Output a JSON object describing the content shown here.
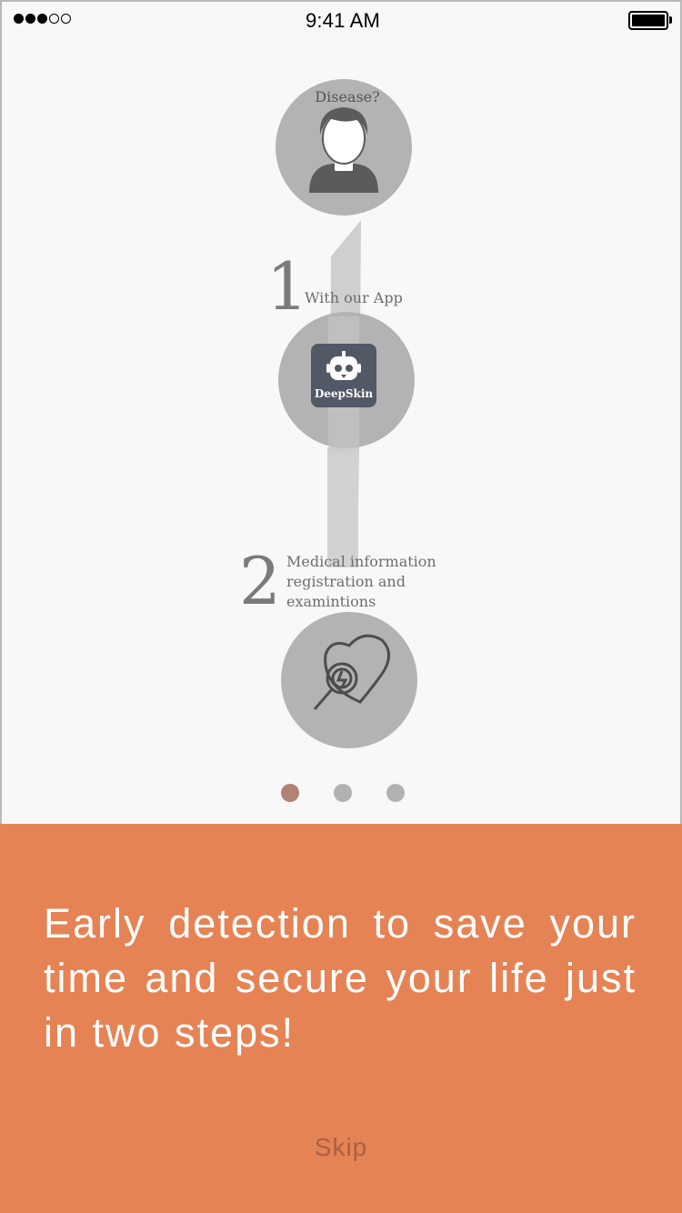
{
  "status_bar": {
    "time": "9:41 AM",
    "signal_filled": 3,
    "signal_total": 5,
    "battery_level": 1.0
  },
  "illustration": {
    "top_bubble": {
      "text": "Disease?",
      "icon": "person-icon"
    },
    "step1": {
      "number": "1",
      "caption": "With our App",
      "app_name": "DeepSkin",
      "icon": "robot-icon"
    },
    "step2": {
      "number": "2",
      "caption_lines": [
        "Medical information",
        "registration and",
        "examintions"
      ],
      "icon": "heart-magnifier-icon"
    }
  },
  "pagination": {
    "count": 3,
    "active_index": 0
  },
  "panel": {
    "headline": "Early detection to save your time and secure your life just in two steps!",
    "skip_label": "Skip"
  },
  "colors": {
    "accent": "#e68355",
    "active_dot": "#b38276",
    "inactive_dot": "#b2b2b2",
    "circle": "#b3b3b3",
    "skip_text": "#a96043"
  }
}
